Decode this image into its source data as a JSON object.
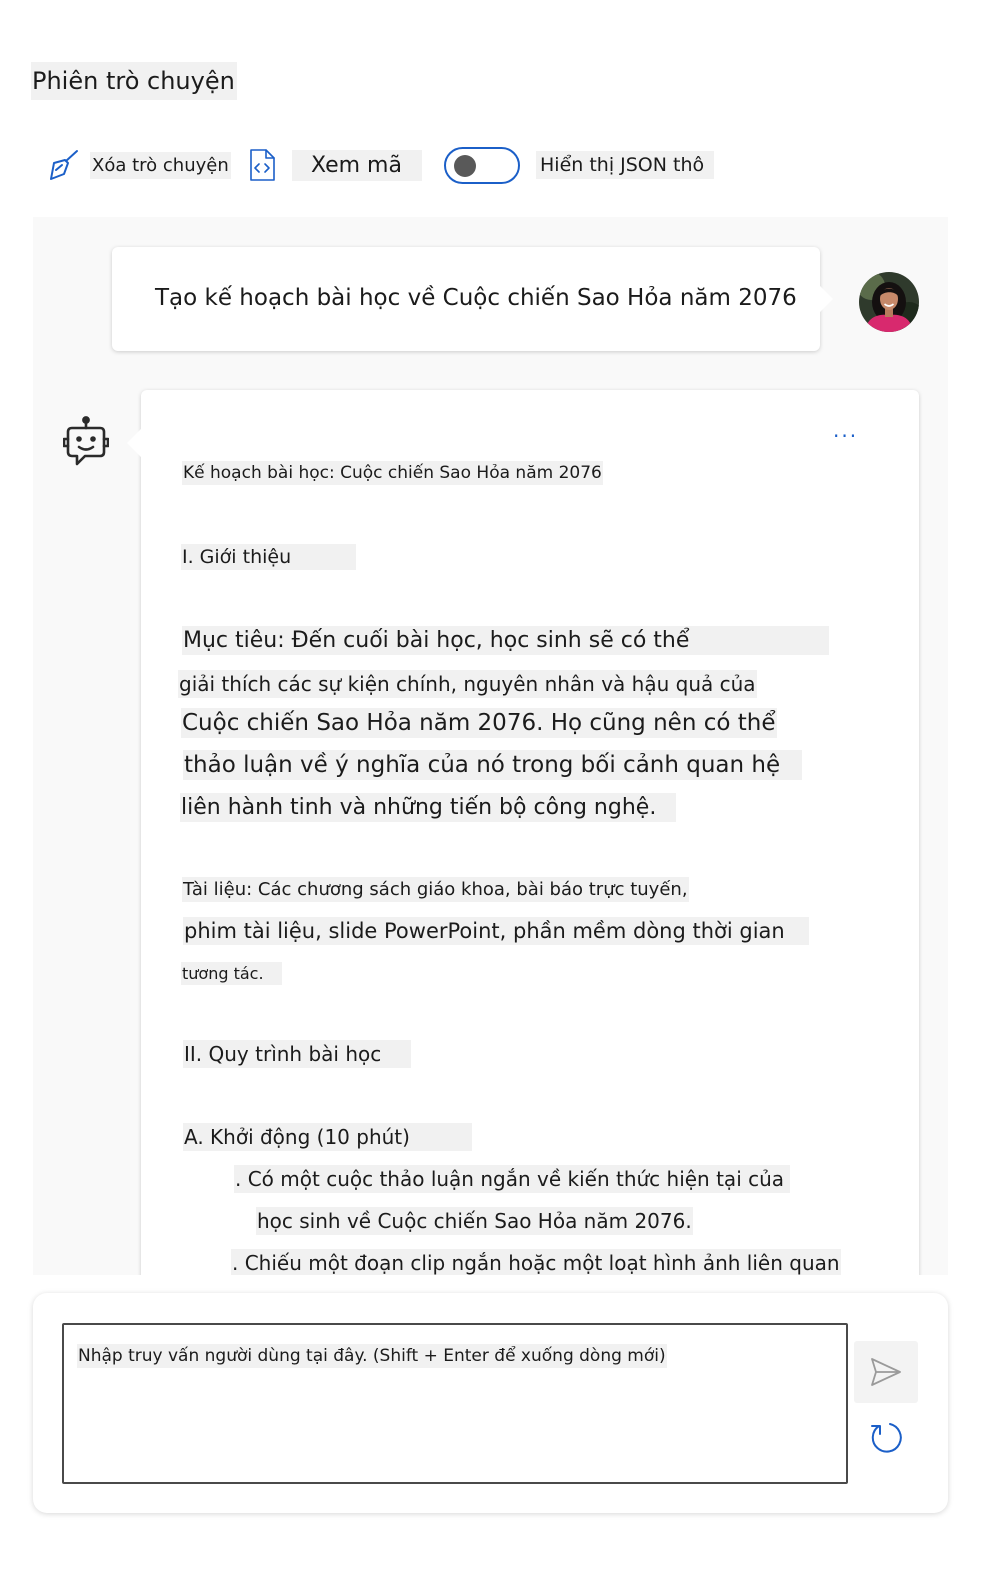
{
  "page": {
    "title": "Phiên trò chuyện"
  },
  "toolbar": {
    "clear_label": "Xóa trò chuyện",
    "view_code_label": "Xem mã",
    "raw_json_label": "Hiển thị JSON thô",
    "raw_json_on": false
  },
  "chat": {
    "user_message": "Tạo kế hoạch bài học về Cuộc chiến Sao Hỏa năm 2076",
    "more_options": "...",
    "assistant_lines": [
      "Kế hoạch bài học: Cuộc chiến Sao Hỏa năm 2076",
      "I. Giới thiệu",
      "Mục tiêu: Đến cuối bài học, học sinh sẽ có thể",
      "giải thích các sự kiện chính, nguyên nhân và hậu quả của",
      "Cuộc chiến Sao Hỏa năm 2076. Họ cũng nên có thể",
      "thảo luận về ý nghĩa của nó trong bối cảnh quan hệ",
      "liên hành tinh và những tiến bộ công nghệ.",
      "Tài liệu: Các chương sách giáo khoa, bài báo trực tuyến,",
      "phim tài liệu, slide PowerPoint, phần mềm dòng thời gian",
      "tương tác.",
      "II. Quy trình bài học",
      "A. Khởi động (10 phút)",
      ". Có một cuộc thảo luận ngắn về kiến thức hiện tại của",
      "học sinh về Cuộc chiến Sao Hỏa năm 2076.",
      ". Chiếu một đoạn clip ngắn hoặc một loạt hình ảnh liên quan"
    ]
  },
  "input": {
    "placeholder": "Nhập truy vấn người dùng tại đây. (Shift + Enter để xuống dòng mới)"
  },
  "icons": {
    "clear": "broom-icon",
    "view_code": "code-file-icon",
    "assistant": "bot-icon",
    "send": "send-icon",
    "reset": "refresh-icon"
  },
  "colors": {
    "accent": "#1b5fc8",
    "highlight": "#f1f1f1",
    "chat_background": "#f9f9f9"
  }
}
